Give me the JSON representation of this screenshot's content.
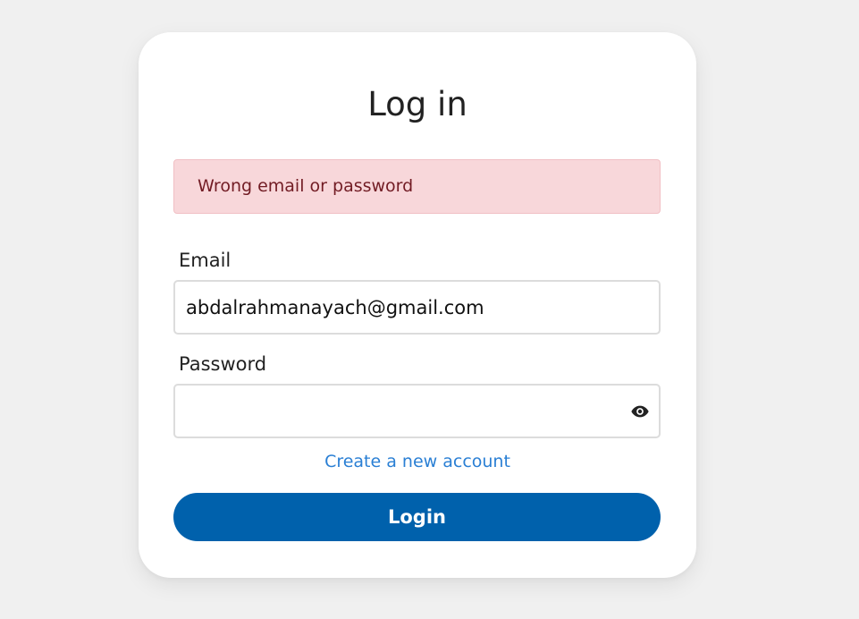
{
  "form": {
    "title": "Log in",
    "error_message": "Wrong email or password",
    "email_label": "Email",
    "email_value": "abdalrahmanayach@gmail.com",
    "password_label": "Password",
    "password_value": "",
    "toggle_icon": "eye-icon",
    "create_account_link": "Create a new account",
    "submit_label": "Login"
  },
  "colors": {
    "background": "#f0f0f0",
    "card": "#ffffff",
    "alert_bg": "#f8d7da",
    "alert_text": "#721c24",
    "link": "#2a7fd4",
    "button": "#0061ac"
  }
}
